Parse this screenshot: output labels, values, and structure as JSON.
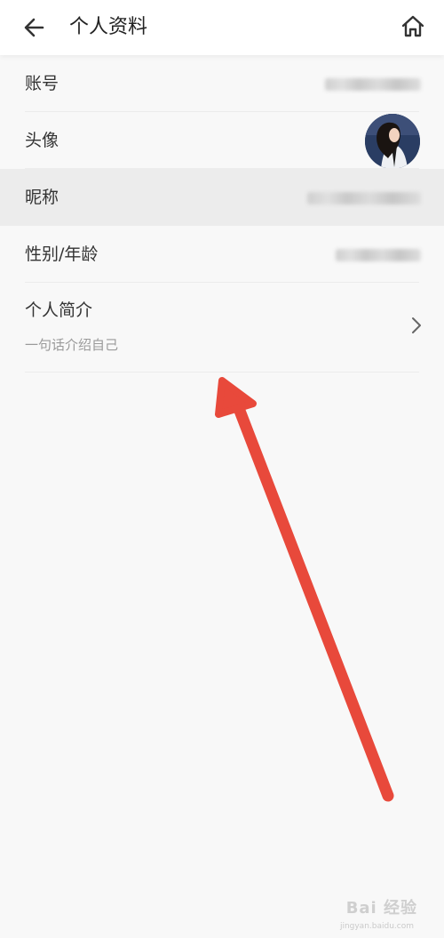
{
  "header": {
    "title": "个人资料",
    "back_icon": "back-arrow-icon",
    "home_icon": "home-icon"
  },
  "rows": [
    {
      "label": "账号",
      "value_visible": false
    },
    {
      "label": "头像"
    },
    {
      "label": "昵称",
      "value_visible": false
    },
    {
      "label": "性别/年龄",
      "value_visible": false
    }
  ],
  "bio": {
    "label": "个人简介",
    "placeholder": "一句话介绍自己",
    "chevron_icon": "chevron-right-icon"
  },
  "annotation": {
    "color": "#e8493b",
    "icon": "red-arrow-annotation"
  },
  "watermark": {
    "text": "Bai 经验",
    "subtext": "jingyan.baidu.com"
  }
}
